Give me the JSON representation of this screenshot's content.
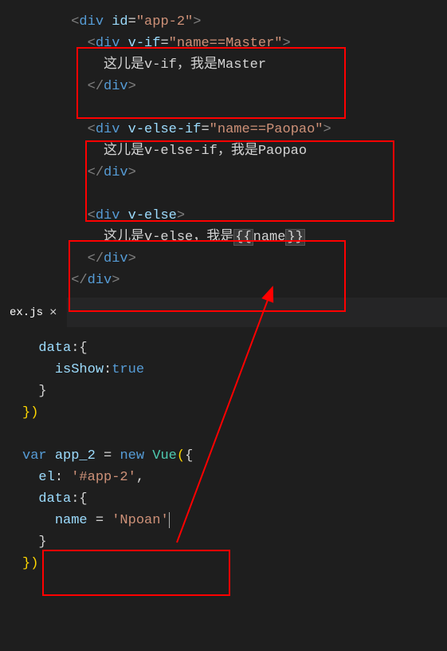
{
  "tab": {
    "filename": "ex.js",
    "close_label": "×"
  },
  "code_upper": {
    "l1_open": "<",
    "l1_tag": "div",
    "l1_attr": "id",
    "l1_val": "\"app-2\"",
    "l1_close": ">",
    "l2_tag": "div",
    "l2_attr": "v-if",
    "l2_val": "\"name==Master\"",
    "l3_text": "这儿是v-if，我是Master",
    "l4_tag": "div",
    "l5_tag": "div",
    "l5_attr": "v-else-if",
    "l5_val": "\"name==Paopao\"",
    "l6_text": "这儿是v-else-if，我是Paopao",
    "l7_tag": "div",
    "l8_tag": "div",
    "l8_attr": "v-else",
    "l9_text_a": "这儿是v-else，我是",
    "l9_expr_open": "{{",
    "l9_expr_name": "name",
    "l9_expr_close": "}}",
    "l10_tag": "div",
    "l11_tag": "div"
  },
  "code_lower": {
    "l1_key": "data",
    "l1_colon": ":",
    "l1_brace": "{",
    "l2_key": "isShow",
    "l2_colon": ":",
    "l2_val": "true",
    "l3_brace": "}",
    "l4_brace": "})",
    "l5_empty": "",
    "l6_var": "var",
    "l6_name": "app_2",
    "l6_eq": "=",
    "l6_new": "new",
    "l6_class": "Vue",
    "l6_paren": "({",
    "l7_key": "el",
    "l7_val": "'#app-2'",
    "l8_key": "data",
    "l8_brace": "{",
    "l9_key": "name",
    "l9_eq": "=",
    "l9_val": "'Npoan'",
    "l10_brace": "}",
    "l11_brace": "})"
  }
}
